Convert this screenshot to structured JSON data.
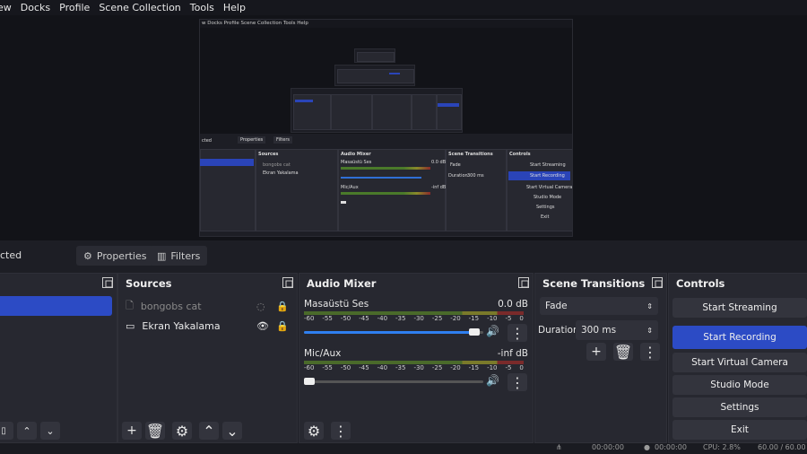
{
  "menu": [
    "ew",
    "Docks",
    "Profile",
    "Scene Collection",
    "Tools",
    "Help"
  ],
  "preview": {
    "menu_text": "w  Docks  Profile  Scene Collection  Tools  Help",
    "nested_sources_title": "Sources",
    "nested_mixer_title": "Audio Mixer",
    "nested_transitions_title": "Scene Transitions",
    "nested_controls_title": "Controls",
    "nested_properties": "Properties",
    "nested_filters": "Filters",
    "nested_selected": "cted",
    "nested_source1": "bongobs cat",
    "nested_source2": "Ekran Yakalama",
    "nested_mix1": "Masaüstü Ses",
    "nested_mix1_db": "0.0 dB",
    "nested_mix2": "Mic/Aux",
    "nested_mix2_db": "-inf dB",
    "nested_fade": "Fade",
    "nested_duration": "Duration",
    "nested_ms": "300 ms",
    "nested_controls": [
      "Start Streaming",
      "Start Recording",
      "Start Virtual Camera",
      "Studio Mode",
      "Settings",
      "Exit"
    ]
  },
  "scenebar": {
    "selected_label": "cted",
    "properties": "Properties",
    "filters": "Filters"
  },
  "sources": {
    "title": "Sources",
    "items": [
      {
        "name": "bongobs cat",
        "visible": false,
        "locked": true
      },
      {
        "name": "Ekran Yakalama",
        "visible": true,
        "locked": true
      }
    ]
  },
  "mixer": {
    "title": "Audio Mixer",
    "channels": [
      {
        "name": "Masaüstü Ses",
        "db": "0.0 dB",
        "volume": 0.98
      },
      {
        "name": "Mic/Aux",
        "db": "-inf dB",
        "volume": 0.05
      }
    ],
    "ticks": [
      "-60",
      "-55",
      "-50",
      "-45",
      "-40",
      "-35",
      "-30",
      "-25",
      "-20",
      "-15",
      "-10",
      "-5",
      "0"
    ]
  },
  "transitions": {
    "title": "Scene Transitions",
    "selected": "Fade",
    "duration_label": "Duration",
    "duration_value": "300 ms"
  },
  "controls": {
    "title": "Controls",
    "buttons": [
      "Start Streaming",
      "Start Recording",
      "Start Virtual Camera",
      "Studio Mode",
      "Settings",
      "Exit"
    ]
  },
  "status": {
    "live_time": "00:00:00",
    "rec_time": "00:00:00",
    "cpu": "CPU: 2.8%",
    "fps": "60.00 / 60.00"
  },
  "colors": {
    "accent": "#2c4bc5",
    "panel": "#272830",
    "bg": "#1d1e25"
  }
}
